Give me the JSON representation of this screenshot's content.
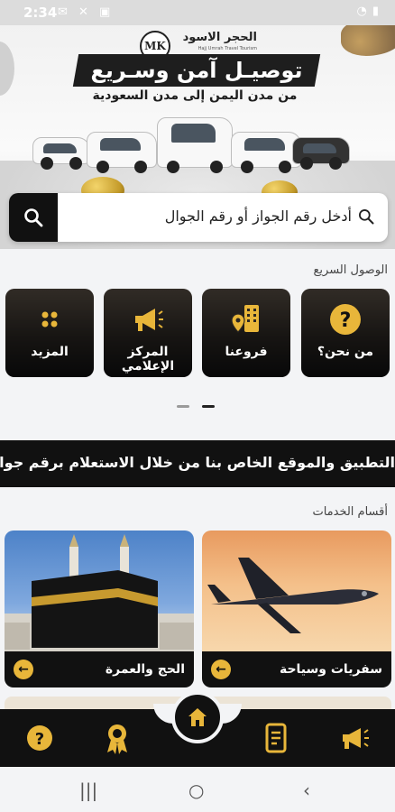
{
  "status_bar": {
    "time": "2:34"
  },
  "banner": {
    "logo_initials": "MK",
    "logo_name": "الحجر الاسود",
    "logo_subtitle": "Hajj Umrah Travel Tourism",
    "headline": "توصيـل آمن وسـريع",
    "subheadline": "من مدن اليمن إلى مدن السعودية"
  },
  "search": {
    "placeholder": "أدخل رقم الجواز أو رقم الجوال"
  },
  "quick_access": {
    "title": "الوصول السريع",
    "items": [
      {
        "label": "من نحن؟",
        "icon": "question-icon"
      },
      {
        "label": "فروعنا",
        "icon": "branch-location-icon"
      },
      {
        "label": "المركز الإعلامي",
        "icon": "megaphone-icon"
      },
      {
        "label": "المزيد",
        "icon": "more-dots-icon"
      }
    ],
    "pager": {
      "pages": 2,
      "active": 1
    }
  },
  "marquee": {
    "text": "التطبيق والموقع الخاص بنا من خلال الاستعلام برقم جوا"
  },
  "services": {
    "title": "أقسام الخدمات",
    "items": [
      {
        "label": "سفريات وسياحة",
        "icon": "airplane-photo"
      },
      {
        "label": "الحج والعمرة",
        "icon": "kaaba-photo"
      }
    ]
  },
  "bottom_nav": {
    "items": [
      "question-icon",
      "award-icon",
      "home-icon",
      "document-icon",
      "megaphone-icon"
    ],
    "active": "home-icon"
  },
  "colors": {
    "accent_gold": "#e8b63a",
    "dark": "#111111",
    "background": "#f3f4f6"
  }
}
